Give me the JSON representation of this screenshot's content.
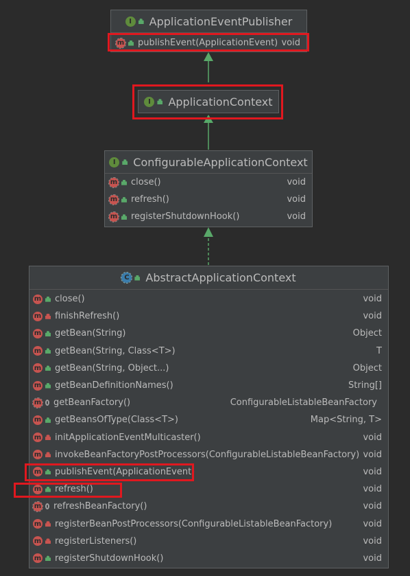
{
  "classes": {
    "publisher": {
      "name": "ApplicationEventPublisher",
      "kind_icon": "interface-icon",
      "methods": [
        {
          "name": "publishEvent(ApplicationEvent)",
          "type": "void",
          "visibility": "public"
        }
      ]
    },
    "context": {
      "name": "ApplicationContext",
      "kind_icon": "interface-icon"
    },
    "configurable": {
      "name": "ConfigurableApplicationContext",
      "kind_icon": "interface-icon",
      "methods": [
        {
          "name": "close()",
          "type": "void",
          "visibility": "public"
        },
        {
          "name": "refresh()",
          "type": "void",
          "visibility": "public"
        },
        {
          "name": "registerShutdownHook()",
          "type": "void",
          "visibility": "public"
        }
      ]
    },
    "abstract": {
      "name": "AbstractApplicationContext",
      "kind_icon": "abstract-class-icon",
      "methods": [
        {
          "name": "close()",
          "type": "void",
          "visibility": "public"
        },
        {
          "name": "finishRefresh()",
          "type": "void",
          "visibility": "private"
        },
        {
          "name": "getBean(String)",
          "type": "Object",
          "visibility": "public"
        },
        {
          "name": "getBean(String, Class<T>)",
          "type": "T",
          "visibility": "public"
        },
        {
          "name": "getBean(String, Object...)",
          "type": "Object",
          "visibility": "public"
        },
        {
          "name": "getBeanDefinitionNames()",
          "type": "String[]",
          "visibility": "public"
        },
        {
          "name": "getBeanFactory()",
          "type": "ConfigurableListableBeanFactory",
          "visibility": "protected"
        },
        {
          "name": "getBeansOfType(Class<T>)",
          "type": "Map<String, T>",
          "visibility": "public"
        },
        {
          "name": "initApplicationEventMulticaster()",
          "type": "void",
          "visibility": "private"
        },
        {
          "name": "invokeBeanFactoryPostProcessors(ConfigurableListableBeanFactory)",
          "type": "void",
          "visibility": "private"
        },
        {
          "name": "publishEvent(ApplicationEvent)",
          "type": "void",
          "visibility": "public"
        },
        {
          "name": "refresh()",
          "type": "void",
          "visibility": "public"
        },
        {
          "name": "refreshBeanFactory()",
          "type": "void",
          "visibility": "protected"
        },
        {
          "name": "registerBeanPostProcessors(ConfigurableListableBeanFactory)",
          "type": "void",
          "visibility": "private"
        },
        {
          "name": "registerListeners()",
          "type": "void",
          "visibility": "private"
        },
        {
          "name": "registerShutdownHook()",
          "type": "void",
          "visibility": "public"
        }
      ]
    }
  },
  "icons": {
    "method": "m",
    "interface": "I",
    "class": "C"
  },
  "colors": {
    "background": "#2b2b2b",
    "box": "#3c3f41",
    "highlight": "#e0181f",
    "arrow": "#59a869"
  }
}
